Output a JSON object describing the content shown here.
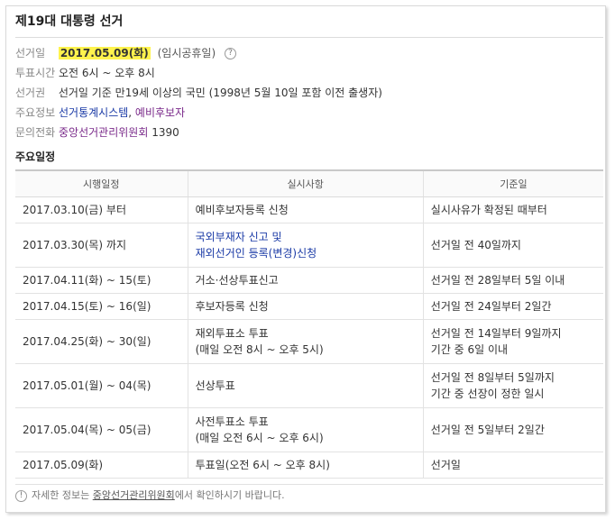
{
  "title": "제19대 대통령 선거",
  "info": {
    "date_label": "선거일",
    "date_value": "2017.05.09(화)",
    "date_note": "(임시공휴일)",
    "help_icon": "?",
    "time_label": "투표시간",
    "time_value": "오전 6시 ~ 오후 8시",
    "right_label": "선거권",
    "right_value": "선거일 기준 만19세 이상의 국민 (1998년 5월 10일 포함 이전 출생자)",
    "main_label": "주요정보",
    "main_link1": "선거통계시스템",
    "main_sep": ", ",
    "main_link2": "예비후보자",
    "phone_label": "문의전화",
    "phone_link": "중앙선거관리위원회",
    "phone_number": "1390"
  },
  "schedule": {
    "section_title": "주요일정",
    "headers": [
      "시행일정",
      "실시사항",
      "기준일"
    ],
    "rows": [
      {
        "date": "2017.03.10(금) 부터",
        "event": "예비후보자등록 신청",
        "basis": "실시사유가 확정된 때부터"
      },
      {
        "date": "2017.03.30(목) 까지",
        "event": "국외부재자 신고 및",
        "event2": "재외선거인 등록(변경)신청",
        "basis": "선거일 전 40일까지"
      },
      {
        "date": "2017.04.11(화) ~ 15(토)",
        "event": "거소·선상투표신고",
        "basis": "선거일 전 28일부터 5일 이내"
      },
      {
        "date": "2017.04.15(토) ~ 16(일)",
        "event": "후보자등록 신청",
        "basis": "선거일 전 24일부터 2일간"
      },
      {
        "date": "2017.04.25(화) ~ 30(일)",
        "event": "재외투표소 투표",
        "event2": "(매일 오전 8시 ~ 오후 5시)",
        "basis": "선거일 전 14일부터 9일까지",
        "basis2": "기간 중 6일 이내"
      },
      {
        "date": "2017.05.01(월) ~ 04(목)",
        "event": "선상투표",
        "basis": "선거일 전 8일부터 5일까지",
        "basis2": "기간 중 선장이 정한 일시"
      },
      {
        "date": "2017.05.04(목) ~ 05(금)",
        "event": "사전투표소 투표",
        "event2": "(매일 오전 6시 ~ 오후 6시)",
        "basis": "선거일 전 5일부터 2일간"
      },
      {
        "date": "2017.05.09(화)",
        "event": "투표일(오전 6시 ~ 오후 8시)",
        "basis": "선거일"
      }
    ]
  },
  "footnote": {
    "icon": "!",
    "prefix": "자세한 정보는 ",
    "link": "중앙선거관리위원회",
    "suffix": "에서 확인하시기 바랍니다."
  }
}
